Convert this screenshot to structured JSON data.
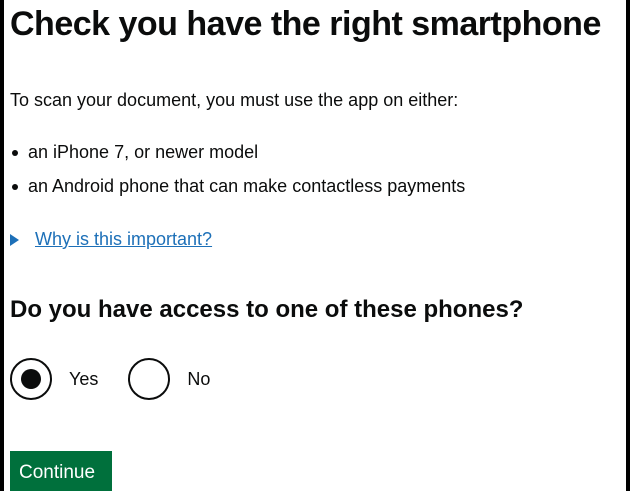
{
  "page": {
    "title": "Check you have the right smartphone",
    "intro": "To scan your document, you must use the app on either:",
    "requirements": [
      "an iPhone 7, or newer model",
      "an Android phone that can make contactless payments"
    ],
    "details_summary": "Why is this important?",
    "question": "Do you have access to one of these phones?",
    "options": [
      {
        "label": "Yes",
        "selected": true
      },
      {
        "label": "No",
        "selected": false
      }
    ],
    "continue_label": "Continue"
  },
  "colors": {
    "text": "#0b0c0c",
    "link": "#1d70b8",
    "button": "#00703c",
    "border": "#000000"
  },
  "icons": {
    "details_toggle": "triangle-right-icon",
    "bullet": "bullet-dot-icon"
  }
}
